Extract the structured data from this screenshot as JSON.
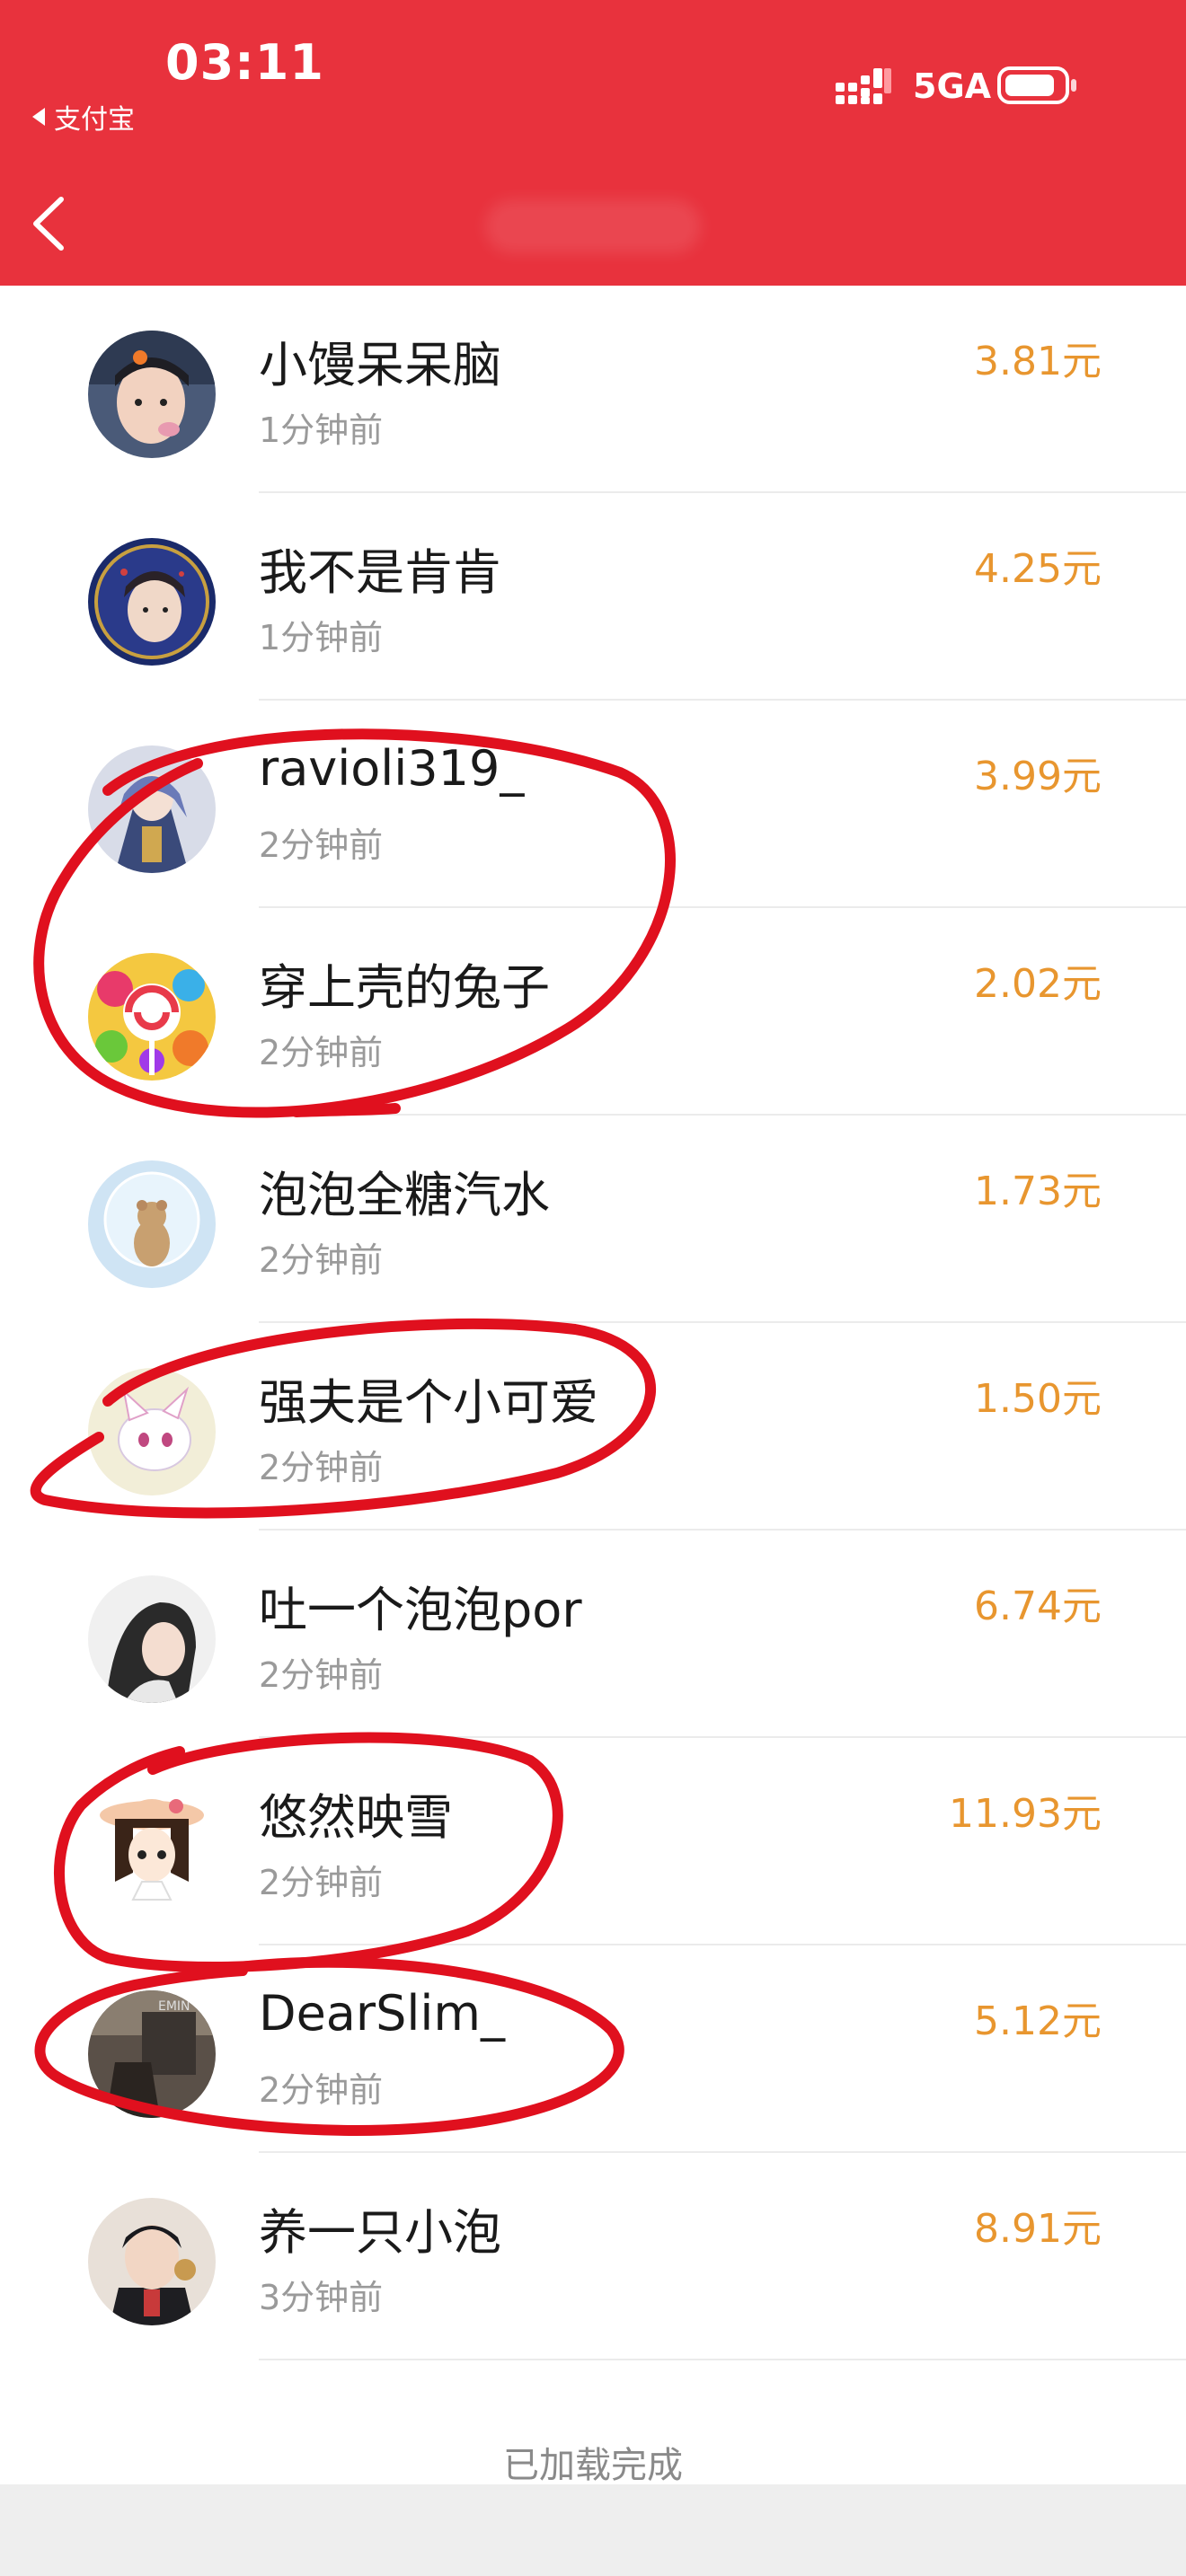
{
  "status": {
    "time": "03:11",
    "back_app": "支付宝",
    "network": "5GA"
  },
  "icons": {
    "back": "chevron-left-icon",
    "signal": "signal-icon",
    "battery": "battery-icon"
  },
  "colors": {
    "header": "#e8323d",
    "amount": "#e8962f",
    "annotation": "#e0101e"
  },
  "list": {
    "items": [
      {
        "name": "小馒呆呆脑",
        "time": "1分钟前",
        "amount": "3.81元"
      },
      {
        "name": "我不是肯肯",
        "time": "1分钟前",
        "amount": "4.25元"
      },
      {
        "name": "ravioli319_",
        "time": "2分钟前",
        "amount": "3.99元"
      },
      {
        "name": "穿上壳的兔子",
        "time": "2分钟前",
        "amount": "2.02元"
      },
      {
        "name": "泡泡全糖汽水",
        "time": "2分钟前",
        "amount": "1.73元"
      },
      {
        "name": "强夫是个小可爱",
        "time": "2分钟前",
        "amount": "1.50元"
      },
      {
        "name": "吐一个泡泡por",
        "time": "2分钟前",
        "amount": "6.74元"
      },
      {
        "name": "悠然映雪",
        "time": "2分钟前",
        "amount": "11.93元"
      },
      {
        "name": "DearSlim_",
        "time": "2分钟前",
        "amount": "5.12元"
      },
      {
        "name": "养一只小泡",
        "time": "3分钟前",
        "amount": "8.91元"
      }
    ],
    "footer": "已加载完成"
  }
}
